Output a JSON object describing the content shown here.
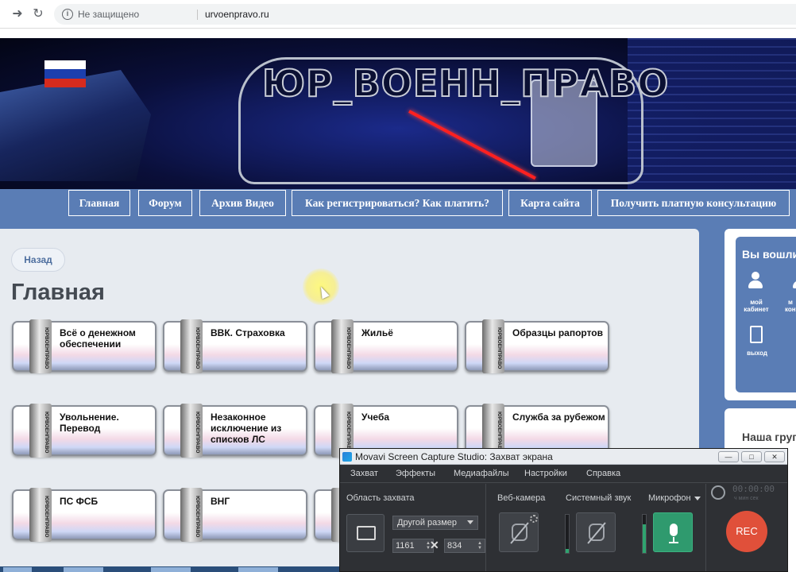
{
  "browser": {
    "security_label": "Не защищено",
    "url": "urvoenpravo.ru"
  },
  "banner": {
    "title": "ЮР_ВОЕНН_ПРАВО"
  },
  "nav": {
    "items": [
      {
        "label": "Главная"
      },
      {
        "label": "Форум"
      },
      {
        "label": "Архив Видео"
      },
      {
        "label": "Как регистрироваться? Как платить?"
      },
      {
        "label": "Карта сайта"
      },
      {
        "label": "Получить платную консультацию"
      }
    ]
  },
  "content": {
    "back_label": "Назад",
    "page_title": "Главная",
    "tab_text": "ЮРВОЕНПРАВО",
    "tiles": [
      {
        "label": "Всё о денежном обеспечении"
      },
      {
        "label": "ВВК. Страховка"
      },
      {
        "label": "Жильё"
      },
      {
        "label": "Образцы рапортов"
      },
      {
        "label": "Увольнение. Перевод"
      },
      {
        "label": "Незаконное исключение из списков ЛС"
      },
      {
        "label": "Учеба"
      },
      {
        "label": "Служба за рубежом"
      },
      {
        "label": "ПС ФСБ"
      },
      {
        "label": "ВНГ"
      }
    ]
  },
  "sidebar": {
    "login_heading": "Вы вошли",
    "cabinet_label": "мой кабинет",
    "cabinet2_label": "м конт",
    "exit_label": "выход",
    "groups_heading": "Наша груп"
  },
  "movavi": {
    "title": "Movavi Screen Capture Studio: Захват экрана",
    "menu": [
      "Захват",
      "Эффекты",
      "Медиафайлы",
      "Настройки",
      "Справка"
    ],
    "capture_area_label": "Область захвата",
    "size_preset": "Другой размер",
    "width": "1161",
    "height": "834",
    "webcam_label": "Веб-камера",
    "system_sound_label": "Системный звук",
    "mic_label": "Микрофон",
    "timer": "00:00:00",
    "timer_units": "ч   мин   сек",
    "rec_label": "REC",
    "mic_level": 0.75,
    "system_level": 0.1
  },
  "colors": {
    "nav_bg": "#5a7db5",
    "content_bg": "#e7ebf0",
    "rec": "#e0503a",
    "mic_active": "#2f9a6e"
  }
}
